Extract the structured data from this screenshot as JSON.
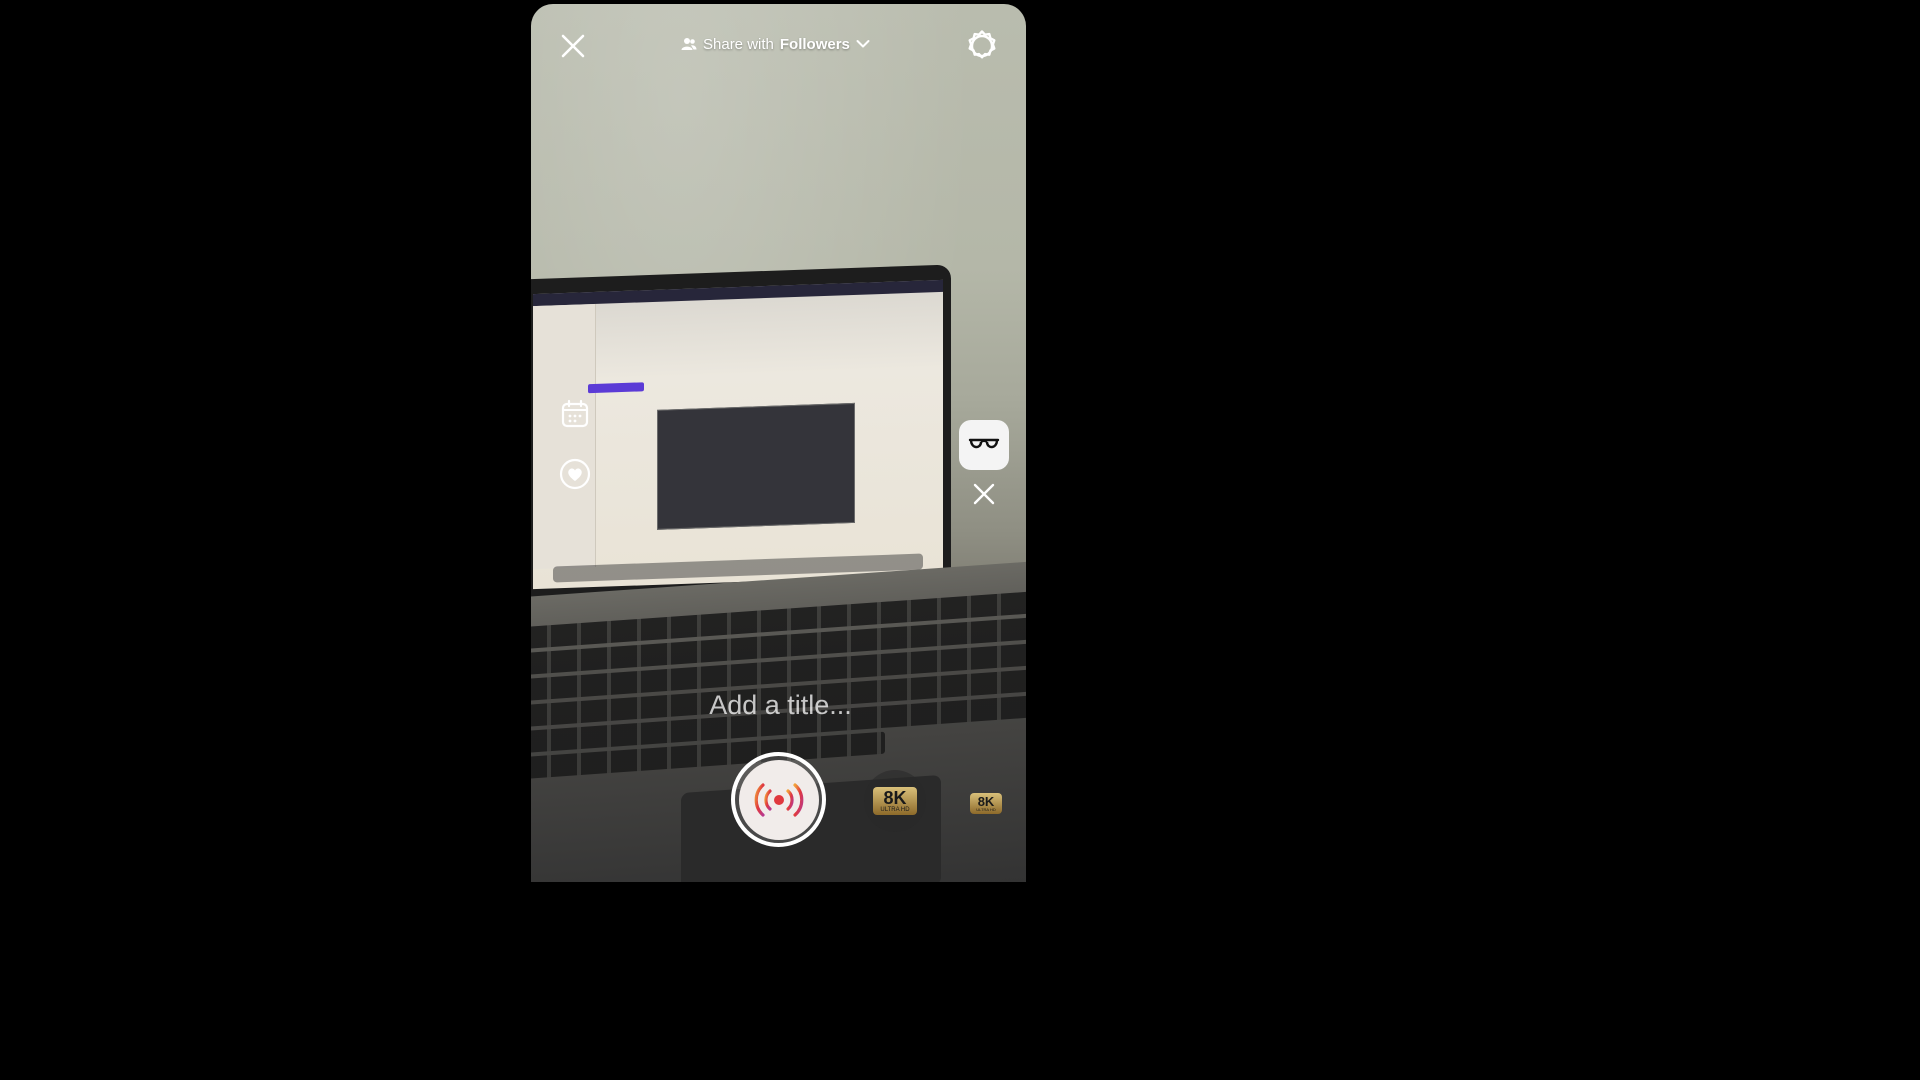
{
  "header": {
    "close_icon": "close-icon",
    "share_prefix": "Share with",
    "share_audience": "Followers",
    "settings_icon": "settings-icon"
  },
  "left_tools": [
    {
      "icon": "calendar-icon"
    },
    {
      "icon": "heart-icon"
    }
  ],
  "right_tools": {
    "glasses_icon": "glasses-icon",
    "close_icon": "close-icon"
  },
  "title_input": {
    "placeholder": "Add a title..."
  },
  "bottom": {
    "live_icon": "live-broadcast-icon",
    "hd_primary": {
      "main": "8K",
      "sub": "ULTRA HD"
    },
    "hd_secondary": {
      "main": "8K",
      "sub": "ULTRA HD"
    }
  },
  "colors": {
    "live_red": "#e0383e",
    "live_orange": "#f2a23a",
    "live_purple": "#b8388f"
  }
}
